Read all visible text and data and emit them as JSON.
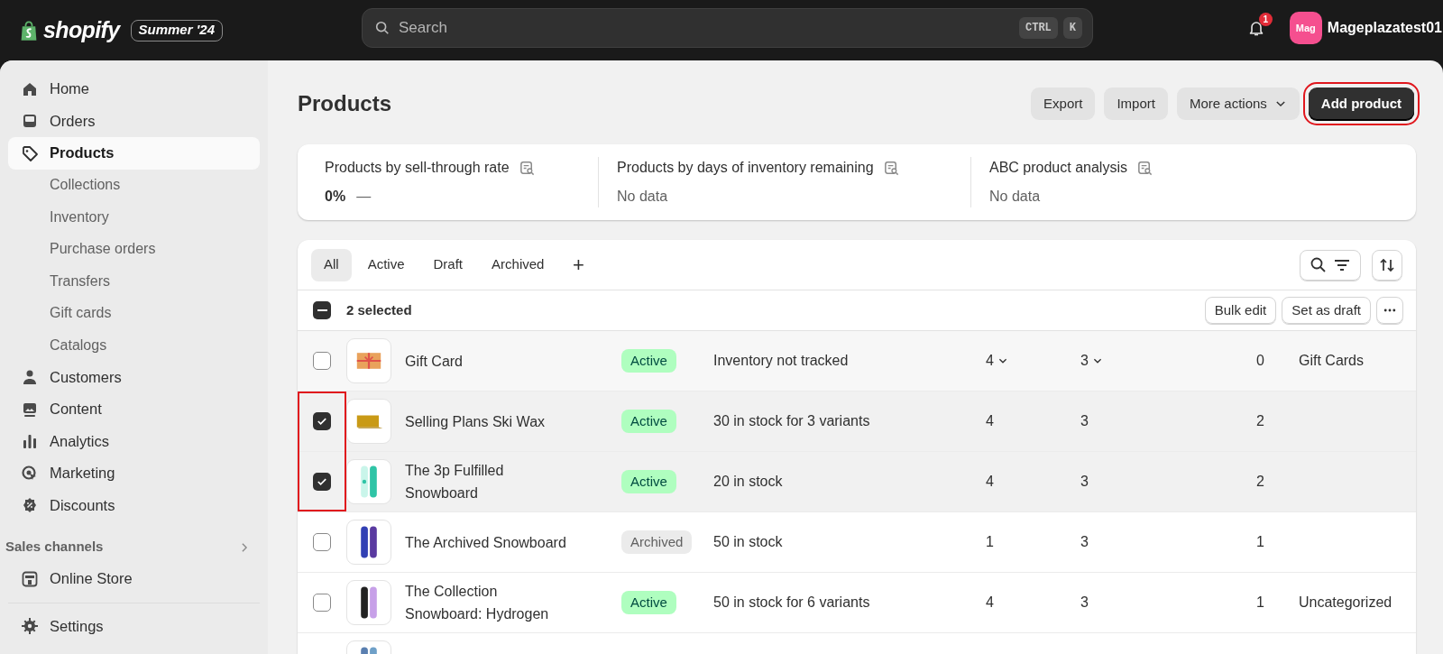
{
  "topbar": {
    "logo_text": "shopify",
    "edition": "Summer '24",
    "search": {
      "placeholder": "Search"
    },
    "shortcut_keys": [
      "CTRL",
      "K"
    ],
    "notification_count": "1",
    "avatar_text": "Mag",
    "store_name": "Mageplazatest01"
  },
  "sidebar": {
    "items": [
      {
        "label": "Home",
        "selected": false
      },
      {
        "label": "Orders",
        "selected": false
      },
      {
        "label": "Products",
        "selected": true,
        "children": [
          {
            "label": "Collections"
          },
          {
            "label": "Inventory"
          },
          {
            "label": "Purchase orders"
          },
          {
            "label": "Transfers"
          },
          {
            "label": "Gift cards"
          },
          {
            "label": "Catalogs"
          }
        ]
      },
      {
        "label": "Customers",
        "selected": false
      },
      {
        "label": "Content",
        "selected": false
      },
      {
        "label": "Analytics",
        "selected": false
      },
      {
        "label": "Marketing",
        "selected": false
      },
      {
        "label": "Discounts",
        "selected": false
      }
    ],
    "section": "Sales channels",
    "channels": [
      {
        "label": "Online Store",
        "selected": false
      }
    ],
    "footer": [
      {
        "label": "Settings",
        "selected": false
      }
    ]
  },
  "page": {
    "title": "Products",
    "actions": [
      {
        "label": "Export",
        "kind": "secondary",
        "highlighted": false
      },
      {
        "label": "Import",
        "kind": "secondary",
        "highlighted": false
      },
      {
        "label": "More actions",
        "kind": "menu",
        "highlighted": false
      },
      {
        "label": "Add product",
        "kind": "primary",
        "highlighted": true
      }
    ]
  },
  "metrics": [
    {
      "title": "Products by sell-through rate",
      "value": "0%",
      "trend": "—"
    },
    {
      "title": "Products by days of inventory remaining",
      "value": "No data"
    },
    {
      "title": "ABC product analysis",
      "value": "No data"
    }
  ],
  "tabs": [
    {
      "label": "All",
      "selected": true
    },
    {
      "label": "Active",
      "selected": false
    },
    {
      "label": "Draft",
      "selected": false
    },
    {
      "label": "Archived",
      "selected": false
    }
  ],
  "add_tab": "+",
  "selection": {
    "label": "2 selected",
    "indeterminate": true,
    "actions": [
      "Bulk edit",
      "Set as draft"
    ]
  },
  "rows": [
    {
      "name": "Gift Card",
      "status": "Active",
      "color": "#affebf",
      "inventory": "Inventory not tracked",
      "column_4": "4",
      "column_5": "3",
      "column_6": "0",
      "category": "Gift Cards",
      "checked": false,
      "hovered": true,
      "highlighted": false
    },
    {
      "name": "Selling Plans Ski Wax",
      "status": "Active",
      "color": "#affebf",
      "inventory": "30 in stock for 3 variants",
      "column_4": "4",
      "column_5": "3",
      "column_6": "2",
      "checked": true,
      "hovered": false,
      "highlighted": true
    },
    {
      "name": "The 3p Fulfilled Snowboard",
      "status": "Active",
      "color": "#affebf",
      "inventory": "20 in stock",
      "column_4": "4",
      "column_5": "3",
      "column_6": "2",
      "checked": true,
      "hovered": false,
      "highlighted": true
    },
    {
      "name": "The Archived Snowboard",
      "status": "Archived",
      "color": "#ebebeb",
      "inventory": "50 in stock",
      "column_4": "1",
      "column_5": "3",
      "column_6": "1",
      "checked": false,
      "hovered": false,
      "highlighted": false
    },
    {
      "name": "The Collection Snowboard: Hydrogen",
      "status": "Active",
      "color": "#affebf",
      "inventory": "50 in stock for 6 variants",
      "column_4": "4",
      "column_5": "3",
      "column_6": "1",
      "category": "Uncategorized",
      "checked": false,
      "hovered": false,
      "highlighted": false
    }
  ]
}
